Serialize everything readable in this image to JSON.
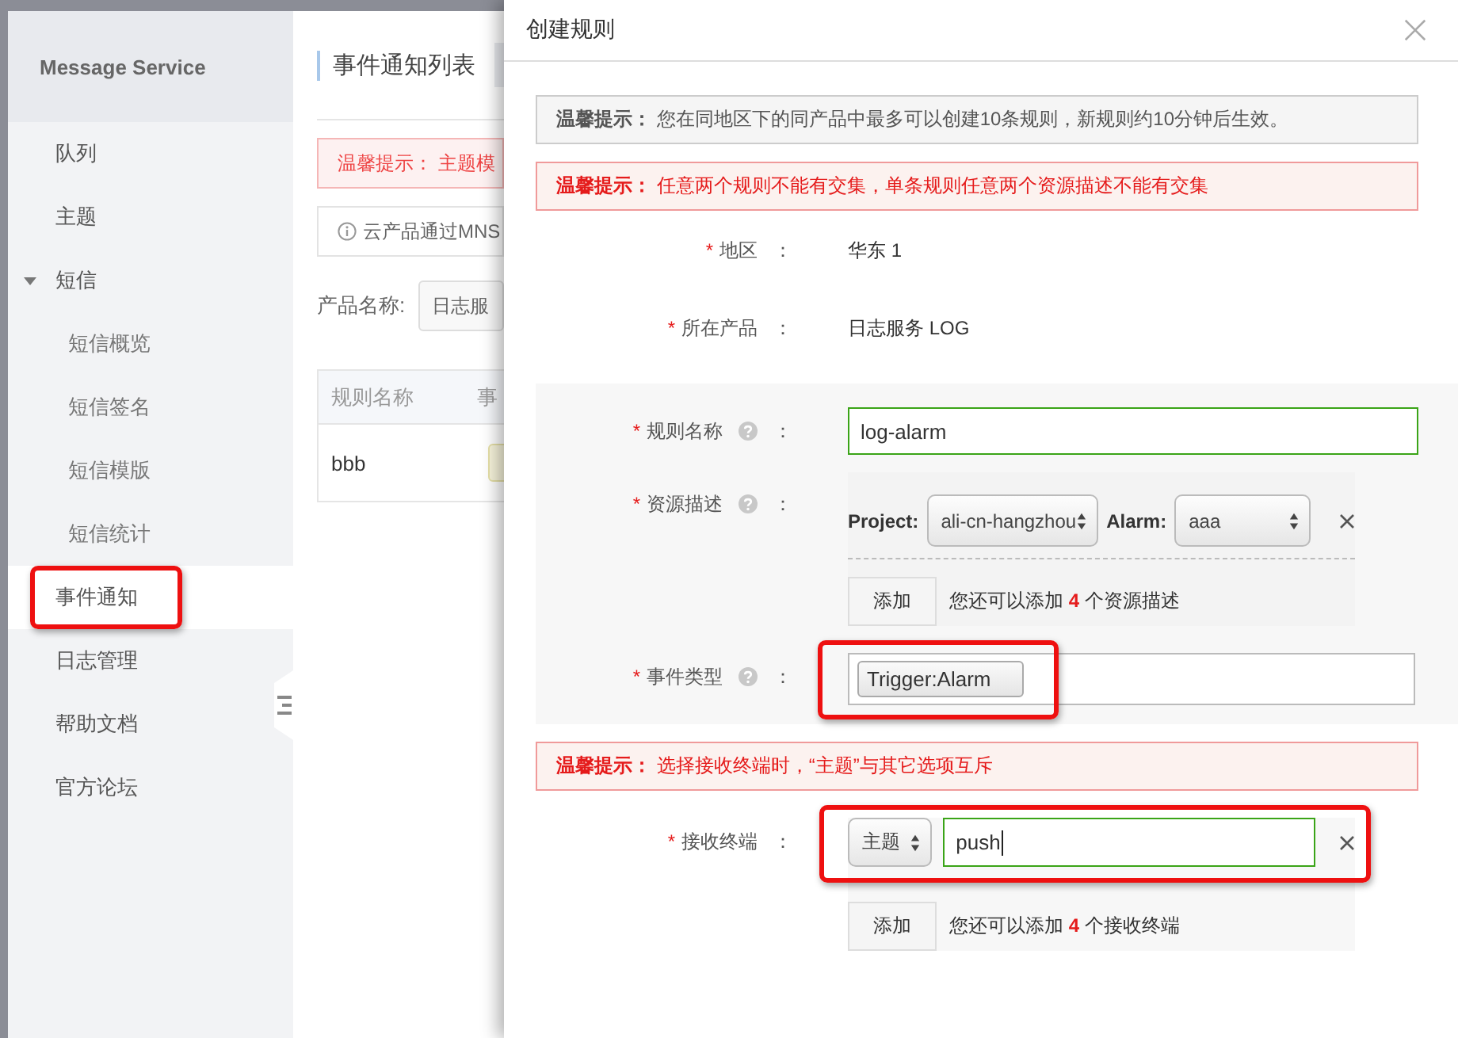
{
  "sidebar": {
    "title": "Message Service",
    "items": [
      {
        "label": "队列",
        "selected": false
      },
      {
        "label": "主题",
        "selected": false
      },
      {
        "label": "短信",
        "selected": false,
        "expanded": true,
        "children": [
          {
            "label": "短信概览",
            "selected": false
          },
          {
            "label": "短信签名",
            "selected": false
          },
          {
            "label": "短信模版",
            "selected": false
          },
          {
            "label": "短信统计",
            "selected": false
          }
        ]
      },
      {
        "label": "事件通知",
        "selected": true,
        "highlighted": true
      },
      {
        "label": "日志管理",
        "selected": false
      },
      {
        "label": "帮助文档",
        "selected": false
      },
      {
        "label": "官方论坛",
        "selected": false
      }
    ]
  },
  "page": {
    "title": "事件通知列表",
    "notice": "**温馨提示：** 主题模",
    "info": "云产品通过MNS",
    "filter": {
      "label": "产品名称:",
      "value": "日志服"
    },
    "table": {
      "columns": [
        "规则名称",
        "事"
      ],
      "rows": [
        [
          "bbb"
        ]
      ]
    }
  },
  "dialog": {
    "title": "创建规则",
    "rows": [
      {
        "kind": "info_notice",
        "text": "**温馨提示：**  您在同地区下的同产品中最多可以创建10条规则，新规则约10分钟后生效。"
      },
      {
        "kind": "warning_notice",
        "text": "**温馨提示：**  任意两个规则不能有交集，单条规则任意两个资源描述不能有交集"
      },
      {
        "kind": "static",
        "required": "*",
        "label": "地区",
        "colon": "：",
        "value": "华东 1"
      },
      {
        "kind": "static",
        "required": "*",
        "label": "所在产品",
        "colon": "：",
        "value": "日志服务 LOG"
      },
      {
        "kind": "section",
        "rows": [
          {
            "kind": "text_input",
            "required": "*",
            "label": "规则名称",
            "help": true,
            "colon": "：",
            "value": "log-alarm"
          },
          {
            "kind": "resources",
            "required": "*",
            "label": "资源描述",
            "help": true,
            "colon": "：",
            "items": [
              {
                "fields": [
                  {
                    "label": "Project:",
                    "value": "ali-cn-hangzhou"
                  },
                  {
                    "label": "Alarm:",
                    "value": "aaa"
                  }
                ]
              }
            ],
            "add_button": "添加",
            "hint": "您还可以添加 **4** 个资源描述"
          },
          {
            "kind": "tags",
            "required": "*",
            "label": "事件类型",
            "help": true,
            "colon": "：",
            "highlighted": true,
            "tags": [
              "Trigger:Alarm"
            ]
          }
        ]
      },
      {
        "kind": "warning_notice",
        "text": "**温馨提示：**  选择接收终端时，“主题”与其它选项互斥"
      },
      {
        "kind": "endpoints",
        "required": "*",
        "label": "接收终端",
        "colon": "：",
        "highlighted": true,
        "items": [
          {
            "type": "主题",
            "value": "push"
          }
        ],
        "add_button": "添加",
        "hint": "您还可以添加 **4** 个接收终端"
      }
    ]
  }
}
